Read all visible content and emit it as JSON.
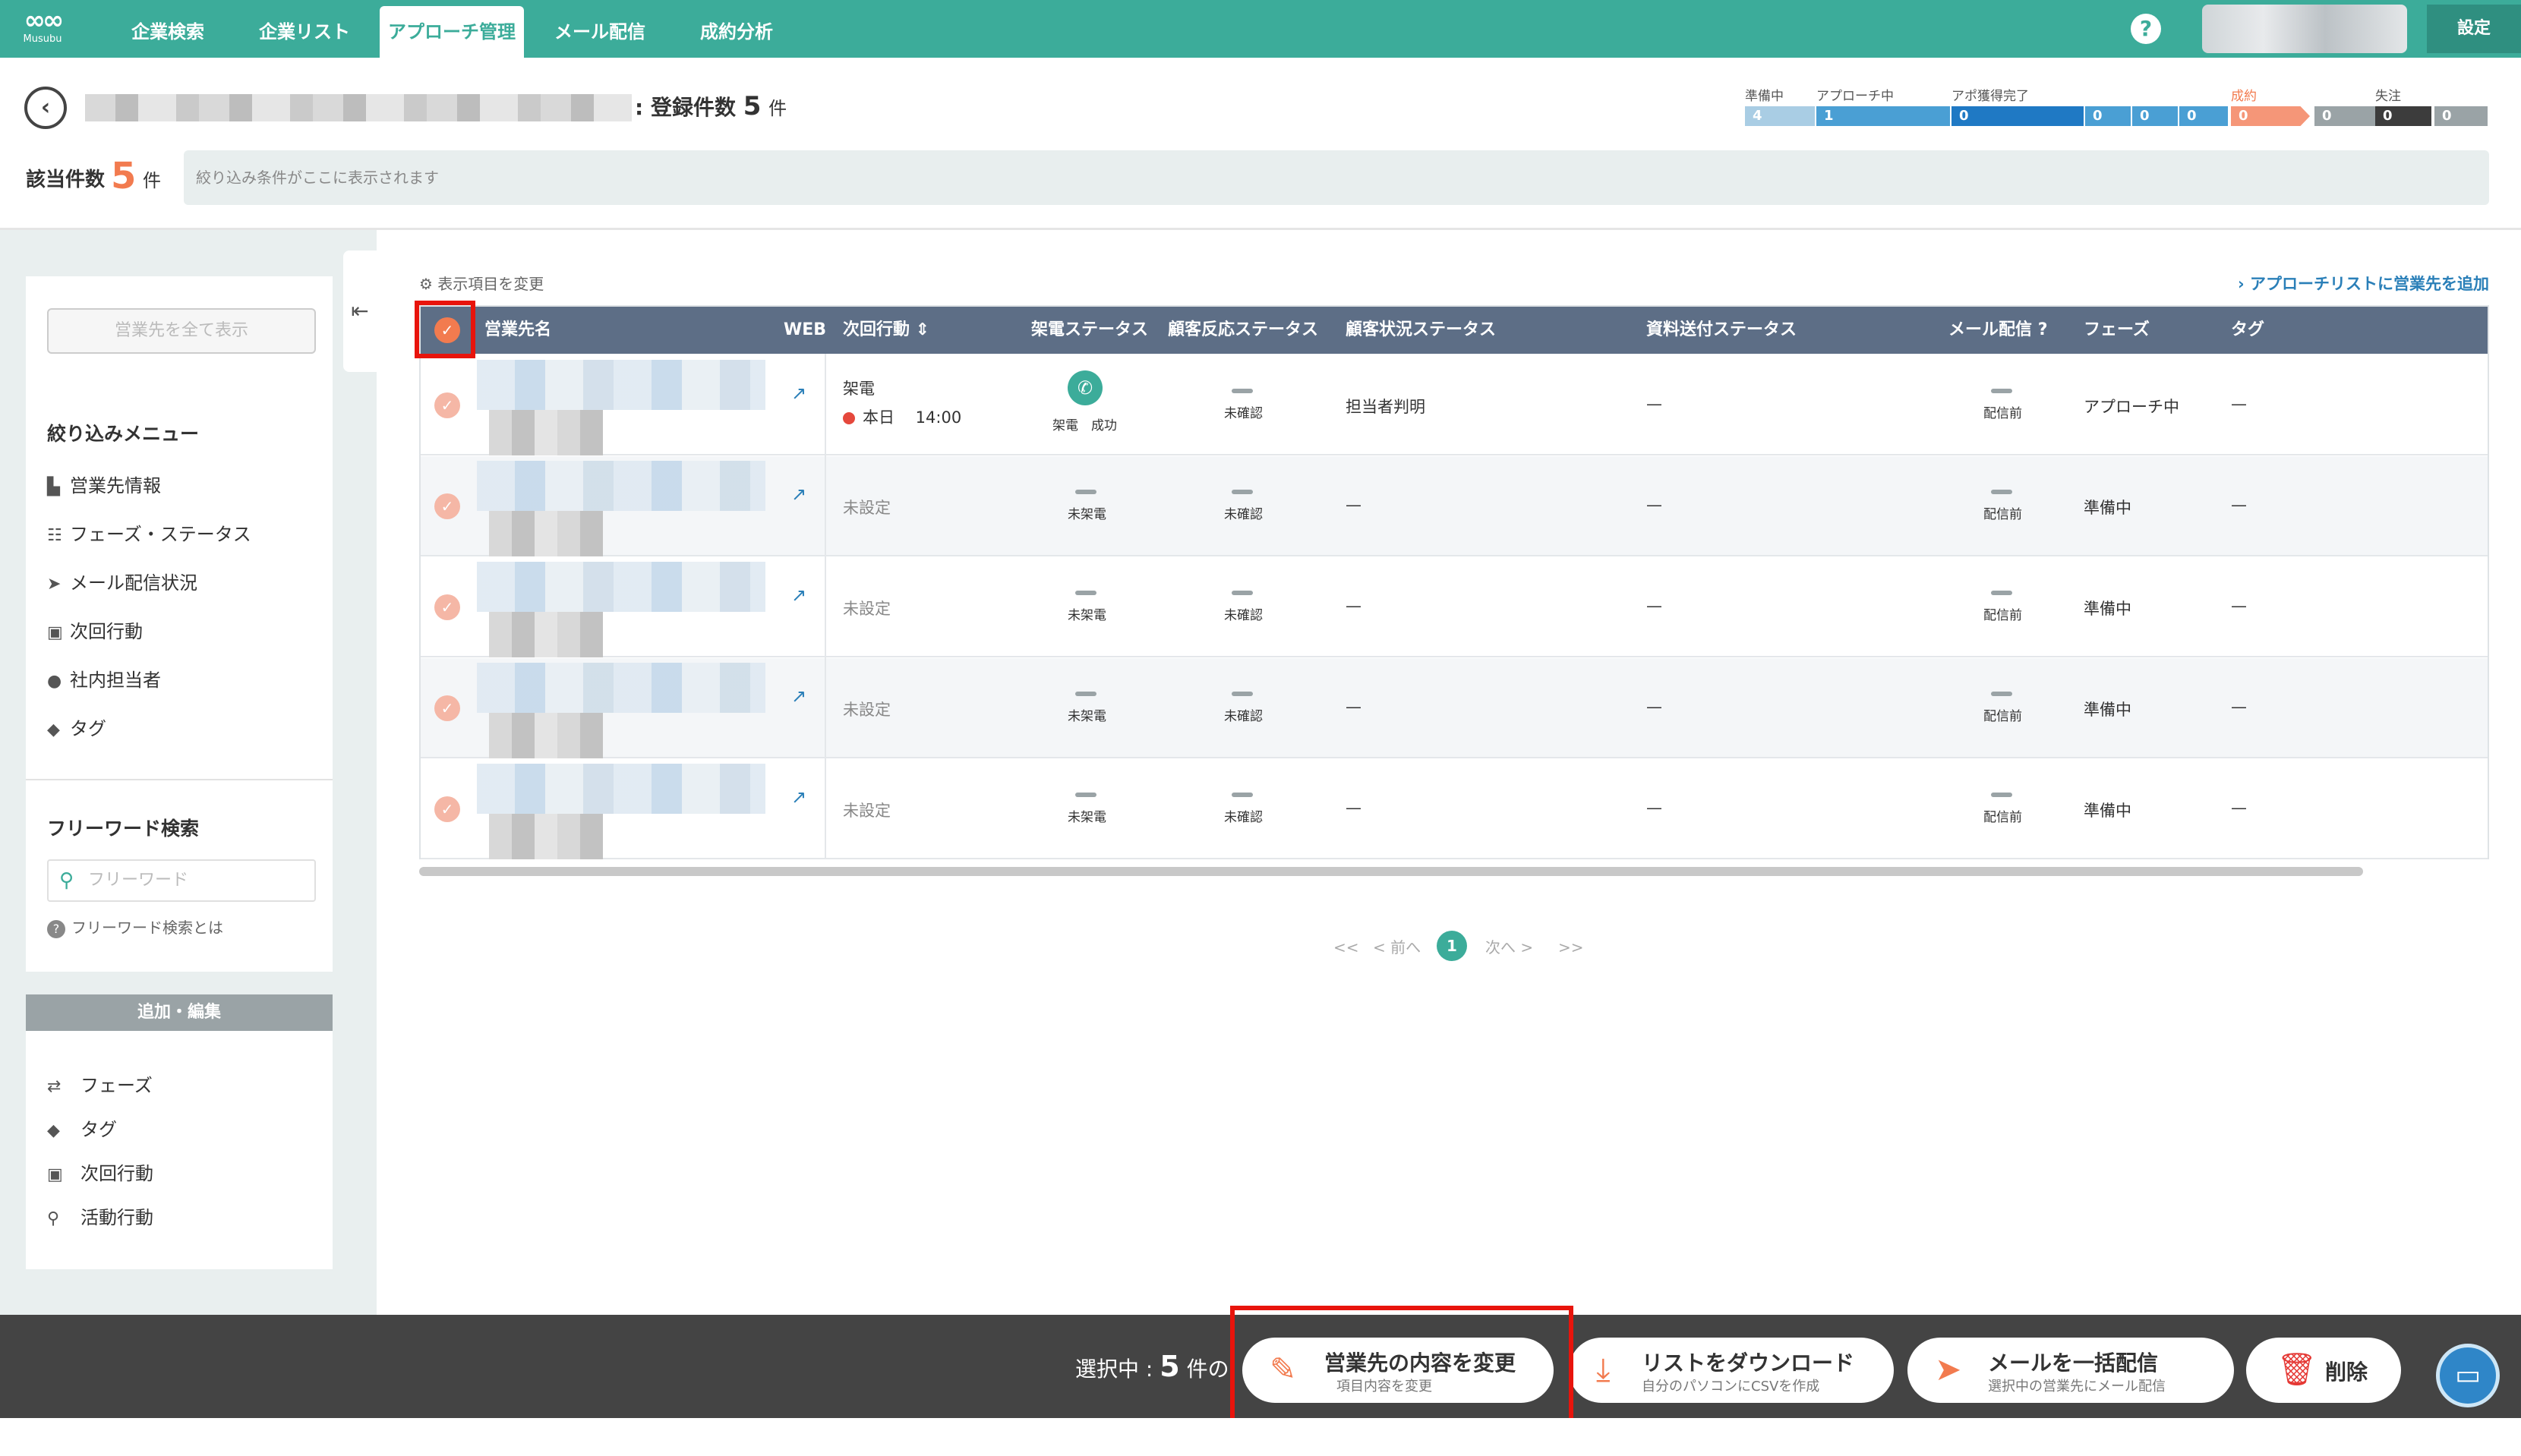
{
  "app": {
    "logo_text": "Musubu"
  },
  "nav": {
    "tabs": [
      "企業検索",
      "企業リスト",
      "アプローチ管理",
      "メール配信",
      "成約分析"
    ],
    "active_tab": "アプローチ管理",
    "help": "?",
    "settings": "設定"
  },
  "header": {
    "back": "‹",
    "reg_prefix": ": 登録件数",
    "reg_count": "5",
    "reg_unit": "件",
    "filter_label": "該当件数",
    "filter_count": "5",
    "filter_unit": "件",
    "filter_placeholder": "絞り込み条件がここに表示されます"
  },
  "phases": [
    {
      "label": "準備中",
      "value": "4",
      "color": "#a9cde4"
    },
    {
      "label": "アプローチ中",
      "value": "1",
      "color": "#4a9fd4"
    },
    {
      "label": "アポ獲得完了",
      "value": "0",
      "color": "#1f79c4"
    },
    {
      "label": "",
      "value": "0",
      "color": "#4a9fd4"
    },
    {
      "label": "",
      "value": "0",
      "color": "#4a9fd4"
    },
    {
      "label": "",
      "value": "0",
      "color": "#4a9fd4"
    },
    {
      "label": "成約",
      "value": "0",
      "color": "#f59678"
    },
    {
      "label": "",
      "value": "0",
      "color": "#9aa3a6"
    },
    {
      "label": "失注",
      "value": "0",
      "color": "#3c3c3c"
    },
    {
      "label": "",
      "value": "0",
      "color": "#9aa3a6"
    }
  ],
  "sidebar": {
    "show_all": "営業先を全て表示",
    "filter_menu_title": "絞り込みメニュー",
    "filter_items": [
      {
        "icon": "▙",
        "label": "営業先情報"
      },
      {
        "icon": "☷",
        "label": "フェーズ・ステータス"
      },
      {
        "icon": "➤",
        "label": "メール配信状況"
      },
      {
        "icon": "▣",
        "label": "次回行動"
      },
      {
        "icon": "●",
        "label": "社内担当者"
      },
      {
        "icon": "◆",
        "label": "タグ"
      }
    ],
    "freeword_title": "フリーワード検索",
    "freeword_placeholder": "フリーワード",
    "freeword_help": "フリーワード検索とは",
    "edit_title": "追加・編集",
    "edit_items": [
      {
        "icon": "⇄",
        "label": "フェーズ"
      },
      {
        "icon": "◆",
        "label": "タグ"
      },
      {
        "icon": "▣",
        "label": "次回行動"
      },
      {
        "icon": "⚲",
        "label": "活動行動"
      }
    ],
    "collapse": "⇤"
  },
  "table": {
    "change_columns": "表示項目を変更",
    "add_to_list": "アプローチリストに営業先を追加",
    "headers": {
      "name": "営業先名",
      "web": "WEB",
      "next_action": "次回行動",
      "call_status": "架電ステータス",
      "reaction_status": "顧客反応ステータス",
      "situation_status": "顧客状況ステータス",
      "document_status": "資料送付ステータス",
      "mail": "メール配信",
      "phase": "フェーズ",
      "tag": "タグ"
    },
    "rows": [
      {
        "next_action": "架電",
        "next_action_date": "本日",
        "next_action_time": "14:00",
        "call_status": "架電　成功",
        "reaction": "未確認",
        "situation": "担当者判明",
        "document": "—",
        "mail": "配信前",
        "phase": "アプローチ中",
        "tag": "—"
      },
      {
        "next_action": "未設定",
        "call_status": "未架電",
        "reaction": "未確認",
        "situation": "—",
        "document": "—",
        "mail": "配信前",
        "phase": "準備中",
        "tag": "—"
      },
      {
        "next_action": "未設定",
        "call_status": "未架電",
        "reaction": "未確認",
        "situation": "—",
        "document": "—",
        "mail": "配信前",
        "phase": "準備中",
        "tag": "—"
      },
      {
        "next_action": "未設定",
        "call_status": "未架電",
        "reaction": "未確認",
        "situation": "—",
        "document": "—",
        "mail": "配信前",
        "phase": "準備中",
        "tag": "—"
      },
      {
        "next_action": "未設定",
        "call_status": "未架電",
        "reaction": "未確認",
        "situation": "—",
        "document": "—",
        "mail": "配信前",
        "phase": "準備中",
        "tag": "—"
      }
    ]
  },
  "pagination": {
    "first": "<<",
    "prev": "< 前へ",
    "current": "1",
    "next": "次へ >",
    "last": ">>"
  },
  "bottom": {
    "selected_label": "選択中 :",
    "selected_count": "5",
    "selected_unit": "件の",
    "buttons": [
      {
        "title": "営業先の内容を変更",
        "sub": "項目内容を変更",
        "icon": "✎",
        "color": "#f27b4f"
      },
      {
        "title": "リストをダウンロード",
        "sub": "自分のパソコンにCSVを作成",
        "icon": "⤓",
        "color": "#f27b4f"
      },
      {
        "title": "メールを一括配信",
        "sub": "選択中の営業先にメール配信",
        "icon": "➤",
        "color": "#f27b4f"
      },
      {
        "title": "削除",
        "sub": "",
        "icon": "🗑",
        "color": "#e53935"
      }
    ]
  }
}
